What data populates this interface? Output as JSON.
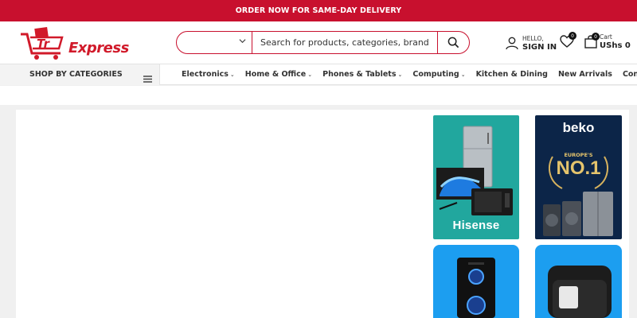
{
  "promo": {
    "text": "ORDER NOW FOR SAME-DAY DELIVERY"
  },
  "brand": {
    "name": "Express"
  },
  "search": {
    "category_value": "",
    "placeholder": "Search for products, categories, brands, sku..."
  },
  "account": {
    "hello": "HELLO,",
    "signin": "SIGN IN"
  },
  "wishlist": {
    "count": "0"
  },
  "cart": {
    "label": "Cart",
    "amount": "UShs 0",
    "count": "0"
  },
  "categories": {
    "label": "SHOP BY CATEGORIES"
  },
  "nav": {
    "items": [
      {
        "label": "Electronics",
        "has_dropdown": true
      },
      {
        "label": "Home & Office",
        "has_dropdown": true
      },
      {
        "label": "Phones & Tablets",
        "has_dropdown": true
      },
      {
        "label": "Computing",
        "has_dropdown": true
      },
      {
        "label": "Kitchen & Dining",
        "has_dropdown": false
      },
      {
        "label": "New Arrivals",
        "has_dropdown": false
      },
      {
        "label": "Contact Us",
        "has_dropdown": false
      }
    ]
  },
  "banners": {
    "hisense": {
      "brand": "Hisense"
    },
    "beko": {
      "brand": "beko",
      "tagline": "EUROPE'S",
      "headline": "NO.1"
    }
  },
  "colors": {
    "accent": "#c8102e",
    "teal": "#21a79e",
    "navy": "#0c2548",
    "blue": "#1c9ef0"
  }
}
